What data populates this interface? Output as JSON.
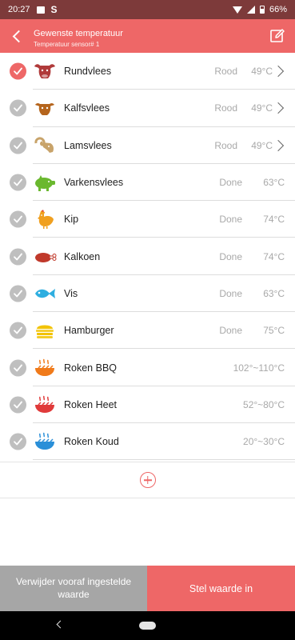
{
  "status_bar": {
    "time": "20:27",
    "battery": "66%"
  },
  "app_bar": {
    "title": "Gewenste temperatuur",
    "subtitle": "Temperatuur sensor# 1"
  },
  "items": [
    {
      "name": "Rundvlees",
      "icon": "cow-head-icon",
      "color": "#b03a3a",
      "level": "Rood",
      "temp": "49°C",
      "has_arrow": true,
      "selected": true
    },
    {
      "name": "Kalfsvlees",
      "icon": "calf-head-icon",
      "color": "#b5651d",
      "level": "Rood",
      "temp": "49°C",
      "has_arrow": true,
      "selected": false
    },
    {
      "name": "Lamsvlees",
      "icon": "ram-head-icon",
      "color": "#c8a36a",
      "level": "Rood",
      "temp": "49°C",
      "has_arrow": true,
      "selected": false
    },
    {
      "name": "Varkensvlees",
      "icon": "pig-icon",
      "color": "#6ab82f",
      "level": "Done",
      "temp": "63°C",
      "has_arrow": false,
      "selected": false
    },
    {
      "name": "Kip",
      "icon": "rooster-icon",
      "color": "#f0a020",
      "level": "Done",
      "temp": "74°C",
      "has_arrow": false,
      "selected": false
    },
    {
      "name": "Kalkoen",
      "icon": "turkey-leg-icon",
      "color": "#c0392b",
      "level": "Done",
      "temp": "74°C",
      "has_arrow": false,
      "selected": false
    },
    {
      "name": "Vis",
      "icon": "fish-icon",
      "color": "#2eaee0",
      "level": "Done",
      "temp": "63°C",
      "has_arrow": false,
      "selected": false
    },
    {
      "name": "Hamburger",
      "icon": "burger-icon",
      "color": "#f2c300",
      "level": "Done",
      "temp": "75°C",
      "has_arrow": false,
      "selected": false
    },
    {
      "name": "Roken BBQ",
      "icon": "grill-bbq-icon",
      "color": "#f07a1a",
      "range": "102°~110°C",
      "has_arrow": false,
      "selected": false
    },
    {
      "name": "Roken Heet",
      "icon": "grill-hot-icon",
      "color": "#e03a3a",
      "range": "52°~80°C",
      "has_arrow": false,
      "selected": false
    },
    {
      "name": "Roken Koud",
      "icon": "grill-cold-icon",
      "color": "#2a8fd8",
      "range": "20°~30°C",
      "has_arrow": false,
      "selected": false
    }
  ],
  "buttons": {
    "remove": "Verwijder vooraf ingestelde waarde",
    "set": "Stel waarde in"
  },
  "colors": {
    "accent": "#ee6767",
    "status_bar": "#7d3a3a",
    "remove_button": "#a6a6a6"
  }
}
